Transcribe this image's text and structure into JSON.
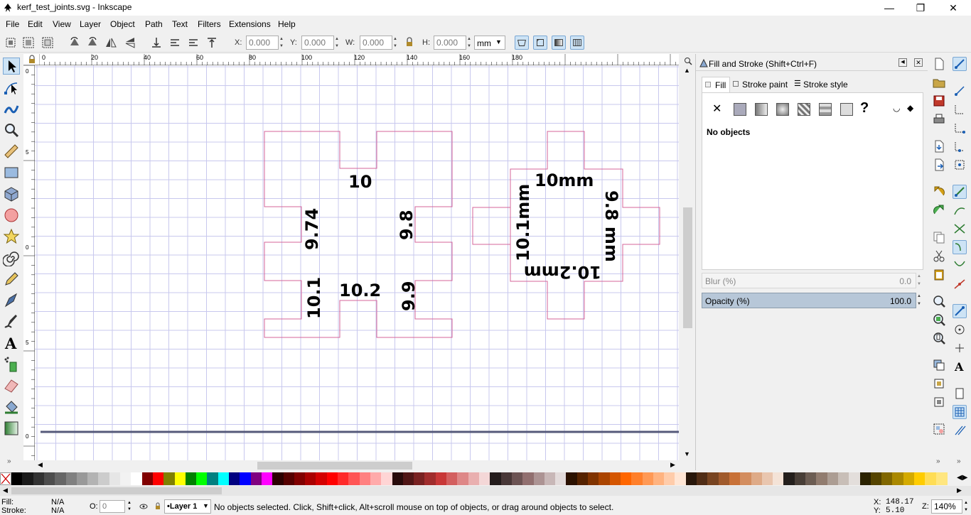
{
  "window": {
    "title": "kerf_test_joints.svg - Inkscape",
    "minimize": "—",
    "maximize": "❐",
    "close": "✕"
  },
  "menu": [
    "File",
    "Edit",
    "View",
    "Layer",
    "Object",
    "Path",
    "Text",
    "Filters",
    "Extensions",
    "Help"
  ],
  "toolbar": {
    "x_label": "X:",
    "x_value": "0.000",
    "y_label": "Y:",
    "y_value": "0.000",
    "w_label": "W:",
    "w_value": "0.000",
    "h_label": "H:",
    "h_value": "0.000",
    "unit": "mm"
  },
  "ruler": {
    "top_ticks": [
      "0",
      "20",
      "40",
      "60",
      "80",
      "100",
      "120",
      "140",
      "160",
      "180"
    ],
    "left_ticks": [
      "0",
      "5",
      "0",
      "5",
      "0"
    ]
  },
  "canvas_labels": {
    "left_top": "10",
    "left_left": "9.74",
    "left_right": "9.8",
    "left_bottom_left": "10.1",
    "left_bottom_mid": "10.2",
    "left_bottom_right": "9.9",
    "right_top": "10mm",
    "right_left": "10.1mm",
    "right_right": "9.8 mm",
    "right_bottom": "10.2mm"
  },
  "dock": {
    "title": "Fill and Stroke (Shift+Ctrl+F)",
    "tabs": [
      "Fill",
      "Stroke paint",
      "Stroke style"
    ],
    "no_objects": "No objects",
    "blur_label": "Blur (%)",
    "blur_value": "0.0",
    "opacity_label": "Opacity (%)",
    "opacity_value": "100.0",
    "unknown_glyph": "?"
  },
  "palette_colors": [
    "#000000",
    "#1a1a1a",
    "#333333",
    "#4d4d4d",
    "#666666",
    "#808080",
    "#999999",
    "#b3b3b3",
    "#cccccc",
    "#e6e6e6",
    "#f2f2f2",
    "#ffffff",
    "#800000",
    "#ff0000",
    "#808000",
    "#ffff00",
    "#008000",
    "#00ff00",
    "#008080",
    "#00ffff",
    "#000080",
    "#0000ff",
    "#800080",
    "#ff00ff",
    "#2b0000",
    "#550000",
    "#800000",
    "#aa0000",
    "#d40000",
    "#ff0000",
    "#ff2a2a",
    "#ff5555",
    "#ff8080",
    "#ffaaaa",
    "#ffd5d5",
    "#280b0b",
    "#501616",
    "#782121",
    "#a02c2c",
    "#c83737",
    "#d35f5f",
    "#de8787",
    "#e9afaf",
    "#f4d7d7",
    "#241c1c",
    "#483737",
    "#6c5353",
    "#916f6f",
    "#ac9393",
    "#c8b7b7",
    "#e3dbdb",
    "#2b1100",
    "#552200",
    "#803300",
    "#aa4400",
    "#d45500",
    "#ff6600",
    "#ff7f2a",
    "#ff9955",
    "#ffb380",
    "#ffccaa",
    "#ffe6d5",
    "#28170b",
    "#502d16",
    "#784421",
    "#a05a2c",
    "#c87137",
    "#d38d5f",
    "#deaa87",
    "#e9c6af",
    "#f4e3d7",
    "#241f1c",
    "#483e37",
    "#6c5d53",
    "#917c6f",
    "#ac9d93",
    "#c8beb7",
    "#e3dedb",
    "#2b2200",
    "#554400",
    "#806600",
    "#aa8800",
    "#d4aa00",
    "#ffcc00",
    "#ffdd55",
    "#ffe680"
  ],
  "status": {
    "fill_label": "Fill:",
    "fill_value": "N/A",
    "stroke_label": "Stroke:",
    "stroke_value": "N/A",
    "opacity_label": "O:",
    "opacity_value": "0",
    "layer": "•Layer 1",
    "message": "No objects selected. Click, Shift+click, Alt+scroll mouse on top of objects, or drag around objects to select.",
    "x_label": "X:",
    "x_value": "148.17",
    "y_label": "Y:",
    "y_value": "5.10",
    "z_label": "Z:",
    "zoom": "140%"
  }
}
